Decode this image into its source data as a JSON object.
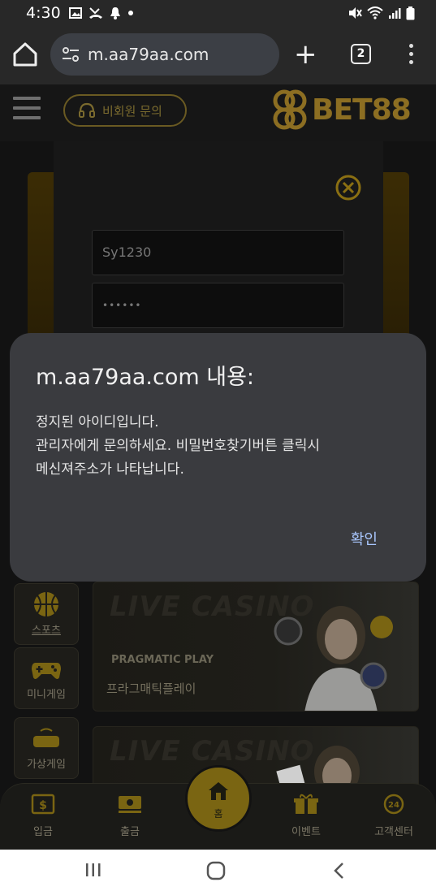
{
  "status_bar": {
    "time": "4:30",
    "notification_icons": [
      "gallery-icon",
      "missed-call-icon",
      "bell-icon",
      "dot-icon"
    ],
    "right_icons": [
      "mute-icon",
      "wifi-icon",
      "signal-icon",
      "battery-icon"
    ]
  },
  "browser": {
    "url": "m.aa79aa.com",
    "tab_count": "2"
  },
  "site": {
    "inquiry_label": "비회원 문의",
    "logo_text": "BET88",
    "logo_color": "#8c6e22",
    "login": {
      "username_value": "Sy1230",
      "password_value": "••••••"
    },
    "side_tiles": [
      {
        "label": "스포츠"
      },
      {
        "label": "미니게임"
      },
      {
        "label": "가상게임"
      }
    ],
    "casino_cards": [
      {
        "watermark": "LIVE CASINO",
        "provider_logo": "PRAGMATIC PLAY",
        "name": "프라그매틱플레이"
      },
      {
        "watermark": "LIVE CASINO"
      }
    ],
    "bottom_nav": {
      "deposit": "입금",
      "withdraw": "출금",
      "home": "홈",
      "event": "이벤트",
      "support": "고객센터"
    }
  },
  "dialog": {
    "title": "m.aa79aa.com 내용:",
    "message_lines": [
      "정지된 아이디입니다.",
      "관리자에게 문의하세요. 비밀번호찾기버튼 클릭시",
      "메신져주소가 나타납니다."
    ],
    "confirm_label": "확인",
    "accent_color": "#a9c7ff"
  }
}
